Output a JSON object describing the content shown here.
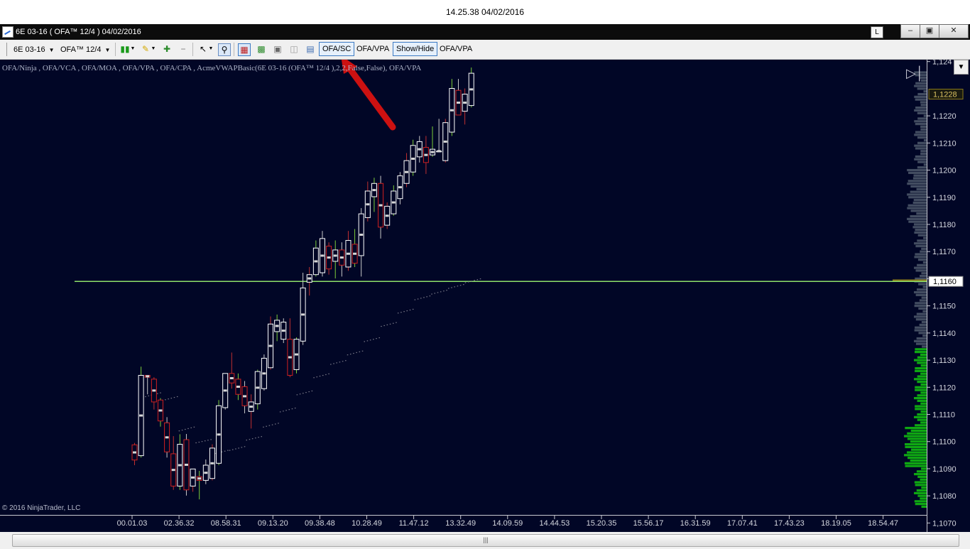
{
  "capture_timestamp": "14.25.38 04/02/2016",
  "window": {
    "title": "6E 03-16 ( OFA™ 12/4 )  04/02/2016",
    "badge": "L",
    "controls": [
      "–",
      "▣",
      "✕"
    ]
  },
  "toolbar": {
    "instrument": "6E 03-16",
    "period": "OFA™ 12/4",
    "buttons": {
      "ofa_sc": "OFA/SC",
      "ofa_vpa_1": "OFA/VPA",
      "show_hide": "Show/Hide",
      "ofa_vpa_2": "OFA/VPA"
    },
    "icons": [
      "candlestick-icon",
      "pencil-icon",
      "zoom-in-icon",
      "zoom-out-icon",
      "cursor-icon",
      "magnifier-icon",
      "strategy-icon",
      "chart-style-icon",
      "screenshot-icon",
      "properties-icon",
      "data-box-icon"
    ]
  },
  "chart": {
    "indicators_text": "OFA/Ninja ,  OFA/VCA  ,  OFA/MOA  ,  OFA/VPA  ,  OFA/CPA  ,  AcmeVWAPBasic(6E 03-16 (OFA™ 12/4 ),2,2,False,False),  OFA/VPA",
    "copyright": "© 2016 NinjaTrader, LLC",
    "colors": {
      "background": "#010626",
      "up_candle": "#ffffff",
      "down_candle": "#d02020",
      "horizontal_line": "#8ee06a",
      "arrow": "#cc1111",
      "volume_profile_low": "#11bb11",
      "volume_profile_high": "#4a5568",
      "marker": "#8a7a1a"
    }
  },
  "chart_data": {
    "type": "candlestick",
    "instrument": "6E 03-16",
    "y_axis": {
      "ticks": [
        "1,1070",
        "1,1080",
        "1,1090",
        "1,1100",
        "1,1110",
        "1,1120",
        "1,1130",
        "1,1140",
        "1,1150",
        "1,1160",
        "1,1170",
        "1,1180",
        "1,1190",
        "1,1200",
        "1,1210",
        "1,1220",
        "1,124"
      ],
      "range": [
        1.10667,
        1.12407
      ],
      "current_price_label": "1,1228",
      "line_label": "1,1160"
    },
    "x_axis": {
      "ticks": [
        "00.01.03",
        "02.36.32",
        "08.58.31",
        "09.13.20",
        "09.38.48",
        "10.28.49",
        "11.47.12",
        "13.32.49",
        "14.09.59",
        "14.44.53",
        "15.20.35",
        "15.56.17",
        "16.31.59",
        "17.07.41",
        "17.43.23",
        "18.19.05",
        "18.54.47"
      ]
    },
    "horizontal_line": 1.1159,
    "candles": [
      {
        "o": 1.10988,
        "h": 1.10995,
        "l": 1.10913,
        "c": 1.10932
      },
      {
        "o": 1.10948,
        "h": 1.11276,
        "l": 1.10941,
        "c": 1.11244
      },
      {
        "o": 1.11244,
        "h": 1.11244,
        "l": 1.11174,
        "c": 1.11237
      },
      {
        "o": 1.1123,
        "h": 1.11237,
        "l": 1.11118,
        "c": 1.11146
      },
      {
        "o": 1.11153,
        "h": 1.1116,
        "l": 1.11055,
        "c": 1.11076
      },
      {
        "o": 1.11069,
        "h": 1.1109,
        "l": 1.10941,
        "c": 1.10962
      },
      {
        "o": 1.10955,
        "h": 1.1102,
        "l": 1.10822,
        "c": 1.10836
      },
      {
        "o": 1.10836,
        "h": 1.11027,
        "l": 1.10822,
        "c": 1.1099
      },
      {
        "o": 1.11007,
        "h": 1.11028,
        "l": 1.10801,
        "c": 1.10822
      },
      {
        "o": 1.10836,
        "h": 1.10892,
        "l": 1.10815,
        "c": 1.10899
      },
      {
        "o": 1.10871,
        "h": 1.10892,
        "l": 1.10787,
        "c": 1.10857
      },
      {
        "o": 1.10857,
        "h": 1.10934,
        "l": 1.10843,
        "c": 1.10913
      },
      {
        "o": 1.10864,
        "h": 1.1099,
        "l": 1.10857,
        "c": 1.10976
      },
      {
        "o": 1.1092,
        "h": 1.11153,
        "l": 1.10913,
        "c": 1.11132
      },
      {
        "o": 1.11125,
        "h": 1.11251,
        "l": 1.11118,
        "c": 1.11251
      },
      {
        "o": 1.11251,
        "h": 1.11328,
        "l": 1.11195,
        "c": 1.11216
      },
      {
        "o": 1.1123,
        "h": 1.11251,
        "l": 1.11153,
        "c": 1.11174
      },
      {
        "o": 1.11202,
        "h": 1.11223,
        "l": 1.11104,
        "c": 1.11132
      },
      {
        "o": 1.11111,
        "h": 1.11174,
        "l": 1.11048,
        "c": 1.11146
      },
      {
        "o": 1.11139,
        "h": 1.11265,
        "l": 1.11118,
        "c": 1.11258
      },
      {
        "o": 1.11195,
        "h": 1.11321,
        "l": 1.11188,
        "c": 1.11307
      },
      {
        "o": 1.11272,
        "h": 1.11461,
        "l": 1.11265,
        "c": 1.11433
      },
      {
        "o": 1.11405,
        "h": 1.11468,
        "l": 1.1137,
        "c": 1.11447
      },
      {
        "o": 1.11377,
        "h": 1.11454,
        "l": 1.11363,
        "c": 1.1144
      },
      {
        "o": 1.11377,
        "h": 1.11454,
        "l": 1.11237,
        "c": 1.11244
      },
      {
        "o": 1.11265,
        "h": 1.11384,
        "l": 1.11251,
        "c": 1.11377
      },
      {
        "o": 1.1137,
        "h": 1.11622,
        "l": 1.11356,
        "c": 1.11566
      },
      {
        "o": 1.11587,
        "h": 1.11643,
        "l": 1.11538,
        "c": 1.11615
      },
      {
        "o": 1.11615,
        "h": 1.11741,
        "l": 1.11608,
        "c": 1.11713
      },
      {
        "o": 1.11622,
        "h": 1.11776,
        "l": 1.11608,
        "c": 1.11748
      },
      {
        "o": 1.1172,
        "h": 1.11734,
        "l": 1.11615,
        "c": 1.11636
      },
      {
        "o": 1.11664,
        "h": 1.11741,
        "l": 1.11601,
        "c": 1.11706
      },
      {
        "o": 1.11706,
        "h": 1.11734,
        "l": 1.11608,
        "c": 1.1165
      },
      {
        "o": 1.11643,
        "h": 1.11776,
        "l": 1.11629,
        "c": 1.11741
      },
      {
        "o": 1.11727,
        "h": 1.11783,
        "l": 1.11643,
        "c": 1.11657
      },
      {
        "o": 1.11685,
        "h": 1.1186,
        "l": 1.11608,
        "c": 1.11839
      },
      {
        "o": 1.11825,
        "h": 1.11958,
        "l": 1.11811,
        "c": 1.11923
      },
      {
        "o": 1.11902,
        "h": 1.11972,
        "l": 1.11846,
        "c": 1.11951
      },
      {
        "o": 1.11951,
        "h": 1.11979,
        "l": 1.11748,
        "c": 1.1179
      },
      {
        "o": 1.11797,
        "h": 1.11881,
        "l": 1.11783,
        "c": 1.11867
      },
      {
        "o": 1.11839,
        "h": 1.11944,
        "l": 1.11832,
        "c": 1.11923
      },
      {
        "o": 1.11895,
        "h": 1.11993,
        "l": 1.11874,
        "c": 1.11979
      },
      {
        "o": 1.11951,
        "h": 1.12063,
        "l": 1.11937,
        "c": 1.12035
      },
      {
        "o": 1.11993,
        "h": 1.12112,
        "l": 1.11979,
        "c": 1.12091
      },
      {
        "o": 1.12049,
        "h": 1.12126,
        "l": 1.12028,
        "c": 1.12105
      },
      {
        "o": 1.12084,
        "h": 1.12126,
        "l": 1.11986,
        "c": 1.12028
      },
      {
        "o": 1.12056,
        "h": 1.12161,
        "l": 1.12049,
        "c": 1.12077
      },
      {
        "o": 1.1207,
        "h": 1.12189,
        "l": 1.1207,
        "c": 1.1207
      },
      {
        "o": 1.12035,
        "h": 1.12189,
        "l": 1.12028,
        "c": 1.12175
      },
      {
        "o": 1.1214,
        "h": 1.12336,
        "l": 1.12126,
        "c": 1.12301
      },
      {
        "o": 1.12294,
        "h": 1.12336,
        "l": 1.12203,
        "c": 1.12203
      },
      {
        "o": 1.12217,
        "h": 1.12301,
        "l": 1.12168,
        "c": 1.1228
      },
      {
        "o": 1.12238,
        "h": 1.12378,
        "l": 1.12231,
        "c": 1.12357
      }
    ],
    "vwap_dots": [
      [
        1.11167,
        1.11181
      ],
      [
        1.11153,
        1.11167
      ],
      [
        1.11041,
        1.11055
      ],
      [
        1.10997,
        1.11009
      ],
      [
        1.10955,
        1.10969
      ],
      [
        1.10969,
        1.10983
      ],
      [
        1.11007,
        1.1102
      ],
      [
        1.11055,
        1.11069
      ],
      [
        1.11111,
        1.11125
      ],
      [
        1.11174,
        1.11188
      ],
      [
        1.11237,
        1.11251
      ],
      [
        1.11286,
        1.113
      ],
      [
        1.11321,
        1.11335
      ],
      [
        1.1137,
        1.11384
      ],
      [
        1.11426,
        1.1144
      ],
      [
        1.11475,
        1.11489
      ],
      [
        1.11524,
        1.11538
      ],
      [
        1.11545,
        1.11559
      ],
      [
        1.11566,
        1.1158
      ],
      [
        1.11587,
        1.11601
      ]
    ]
  }
}
